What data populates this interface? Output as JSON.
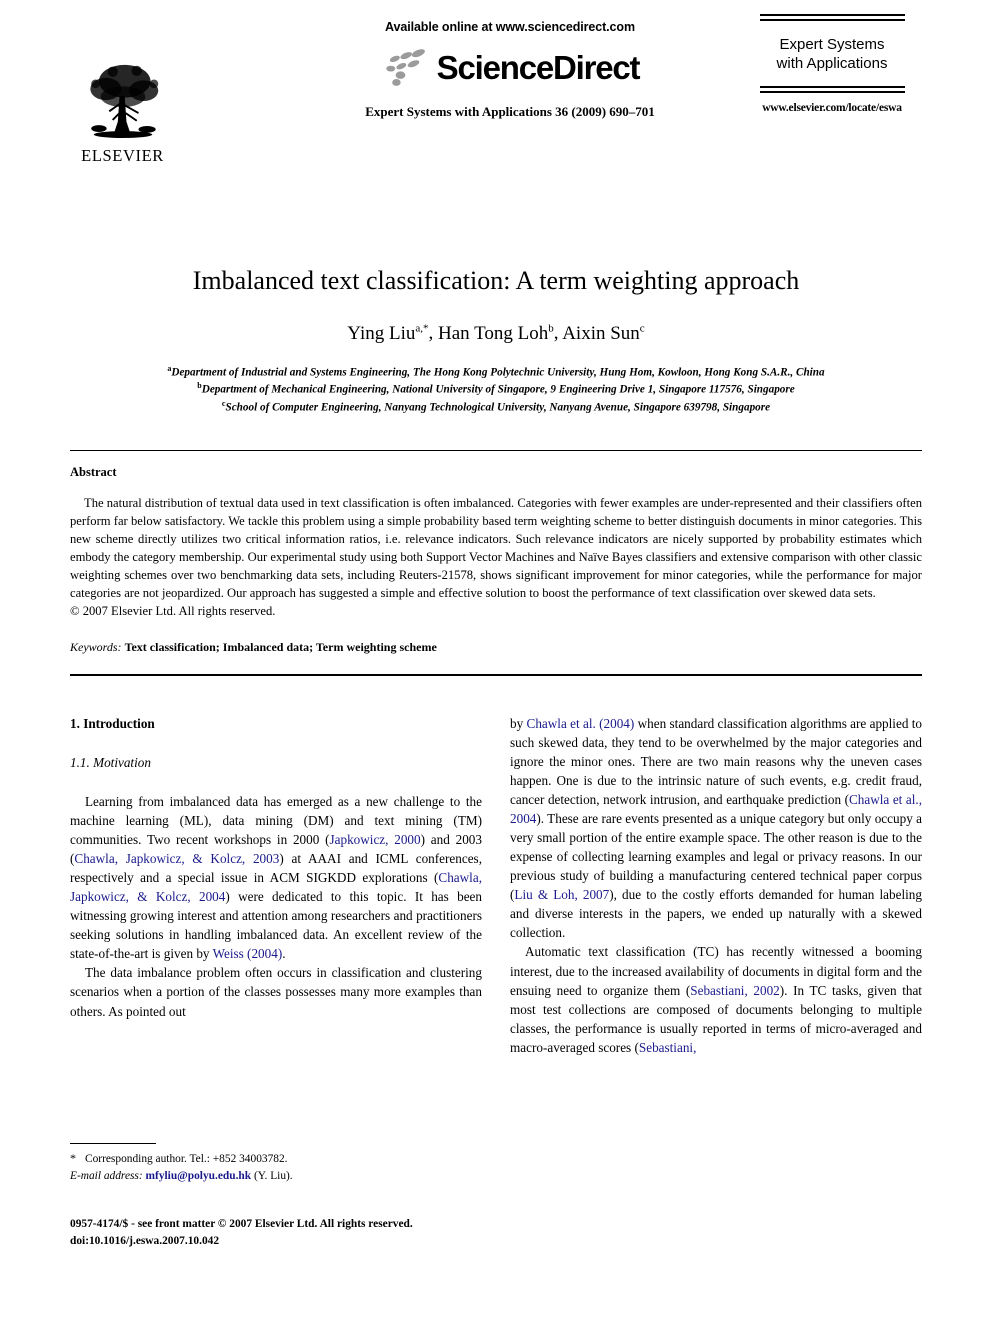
{
  "publisher": {
    "name": "ELSEVIER",
    "logo_icon": "elsevier-tree-logo"
  },
  "header": {
    "available_online": "Available online at www.sciencedirect.com",
    "sciencedirect_wordmark": "ScienceDirect",
    "sciencedirect_icon": "sciencedirect-dots-logo",
    "journal_citation": "Expert Systems with Applications 36 (2009) 690–701",
    "journal_title_line1": "Expert Systems",
    "journal_title_line2": "with Applications",
    "journal_url": "www.elsevier.com/locate/eswa"
  },
  "article": {
    "title": "Imbalanced text classification: A term weighting approach",
    "authors": [
      {
        "name": "Ying Liu",
        "marks": "a,*"
      },
      {
        "name": "Han Tong Loh",
        "marks": "b"
      },
      {
        "name": "Aixin Sun",
        "marks": "c"
      }
    ],
    "authors_separator": ", ",
    "affiliations": [
      {
        "mark": "a",
        "text": "Department of Industrial and Systems Engineering, The Hong Kong Polytechnic University, Hung Hom, Kowloon, Hong Kong S.A.R., China"
      },
      {
        "mark": "b",
        "text": "Department of Mechanical Engineering, National University of Singapore, 9 Engineering Drive 1, Singapore 117576, Singapore"
      },
      {
        "mark": "c",
        "text": "School of Computer Engineering, Nanyang Technological University, Nanyang Avenue, Singapore 639798, Singapore"
      }
    ]
  },
  "abstract": {
    "heading": "Abstract",
    "text": "The natural distribution of textual data used in text classification is often imbalanced. Categories with fewer examples are under-represented and their classifiers often perform far below satisfactory. We tackle this problem using a simple probability based term weighting scheme to better distinguish documents in minor categories. This new scheme directly utilizes two critical information ratios, i.e. relevance indicators. Such relevance indicators are nicely supported by probability estimates which embody the category membership. Our experimental study using both Support Vector Machines and Naïve Bayes classifiers and extensive comparison with other classic weighting schemes over two benchmarking data sets, including Reuters-21578, shows significant improvement for minor categories, while the performance for major categories are not jeopardized. Our approach has suggested a simple and effective solution to boost the performance of text classification over skewed data sets.",
    "copyright": "© 2007 Elsevier Ltd. All rights reserved.",
    "keywords_label": "Keywords:",
    "keywords_values": "Text classification; Imbalanced data; Term weighting scheme"
  },
  "body": {
    "section_number_title": "1. Introduction",
    "subsection_number_title": "1.1. Motivation",
    "left_column": {
      "p1_part1": "Learning from imbalanced data has emerged as a new challenge to the machine learning (ML), data mining (DM) and text mining (TM) communities. Two recent workshops in 2000 (",
      "p1_cite1": "Japkowicz, 2000",
      "p1_part2": ") and 2003 (",
      "p1_cite2": "Chawla, Japkowicz, & Kolcz, 2003",
      "p1_part3": ") at AAAI and ICML conferences, respectively and a special issue in ACM SIGKDD explorations (",
      "p1_cite3": "Chawla, Japkowicz, & Kolcz, 2004",
      "p1_part4": ") were dedicated to this topic. It has been witnessing growing interest and attention among researchers and practitioners seeking solutions in handling imbalanced data. An excellent review of the state-of-the-art is given by ",
      "p1_cite4": "Weiss (2004)",
      "p1_part5": ".",
      "p2_part1": "The data imbalance problem often occurs in classification and clustering scenarios when a portion of the classes possesses many more examples than others. As pointed out"
    },
    "right_column": {
      "p2_cont_part1": "by ",
      "p2_cite1": "Chawla et al. (2004)",
      "p2_part2": " when standard classification algorithms are applied to such skewed data, they tend to be overwhelmed by the major categories and ignore the minor ones. There are two main reasons why the uneven cases happen. One is due to the intrinsic nature of such events, e.g. credit fraud, cancer detection, network intrusion, and earthquake prediction (",
      "p2_cite2": "Chawla et al., 2004",
      "p2_part3": "). These are rare events presented as a unique category but only occupy a very small portion of the entire example space. The other reason is due to the expense of collecting learning examples and legal or privacy reasons. In our previous study of building a manufacturing centered technical paper corpus (",
      "p2_cite3": "Liu & Loh, 2007",
      "p2_part4": "), due to the costly efforts demanded for human labeling and diverse interests in the papers, we ended up naturally with a skewed collection.",
      "p3_part1": "Automatic text classification (TC) has recently witnessed a booming interest, due to the increased availability of documents in digital form and the ensuing need to organize them (",
      "p3_cite1": "Sebastiani, 2002",
      "p3_part2": "). In TC tasks, given that most test collections are composed of documents belonging to multiple classes, the performance is usually reported in terms of micro-averaged and macro-averaged scores (",
      "p3_cite2": "Sebastiani,",
      "p3_part3": ""
    }
  },
  "footnote": {
    "star": "*",
    "corresponding": "Corresponding author. Tel.: +852 34003782.",
    "email_label": "E-mail address:",
    "email": "mfyliu@polyu.edu.hk",
    "email_suffix": "(Y. Liu)."
  },
  "page_footer": {
    "line1": "0957-4174/$ - see front matter © 2007 Elsevier Ltd. All rights reserved.",
    "line2": "doi:10.1016/j.eswa.2007.10.042"
  },
  "colors": {
    "citation_link": "#1a1a8c",
    "text": "#000000",
    "background": "#ffffff",
    "sciencedirect_dots": "#9b9b9b"
  }
}
